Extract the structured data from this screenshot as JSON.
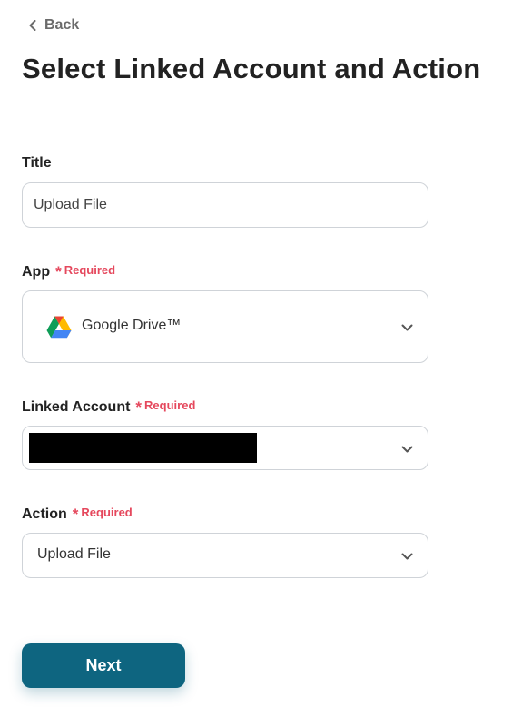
{
  "nav": {
    "back_label": "Back",
    "back_icon": "chevron-left-icon"
  },
  "page": {
    "title": "Select Linked Account and Action"
  },
  "form": {
    "required_label": "Required",
    "required_marker": "*",
    "title_field": {
      "label": "Title",
      "value": "Upload File"
    },
    "app_field": {
      "label": "App",
      "value": "Google Drive™",
      "icon": "google-drive-icon"
    },
    "linked_account_field": {
      "label": "Linked Account",
      "value_redacted": true
    },
    "action_field": {
      "label": "Action",
      "value": "Upload File"
    }
  },
  "footer": {
    "next_label": "Next"
  },
  "colors": {
    "primary_button": "#0e6580",
    "required_text": "#e5485d",
    "border": "#cfd3d8",
    "muted_text": "#6b6b6b"
  }
}
